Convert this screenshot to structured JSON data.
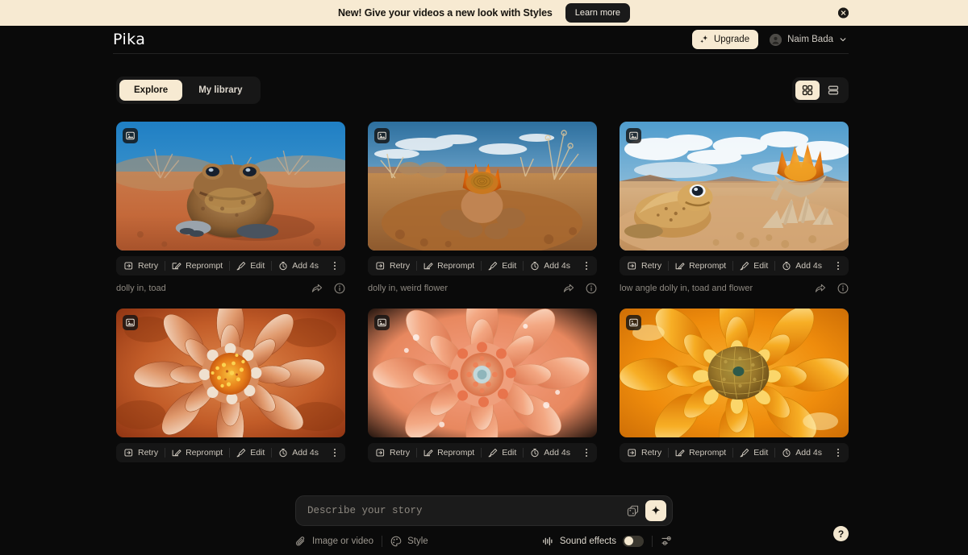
{
  "banner": {
    "text": "New! Give your videos a new look with Styles",
    "cta_label": "Learn more",
    "close_icon": "close-circle-icon",
    "background": "#f7ead2"
  },
  "header": {
    "logo": "Pika",
    "upgrade_label": "Upgrade",
    "upgrade_icon": "sparkle-icon",
    "user_name": "Naim Bada",
    "chevron_icon": "chevron-down-icon",
    "avatar_icon": "avatar-icon"
  },
  "toolbar": {
    "tabs": [
      {
        "label": "Explore",
        "active": true
      },
      {
        "label": "My library",
        "active": false
      }
    ],
    "views": [
      {
        "icon": "grid-view-icon",
        "active": true
      },
      {
        "icon": "list-view-icon",
        "active": false
      }
    ]
  },
  "card_actions": {
    "retry": "Retry",
    "reprompt": "Reprompt",
    "edit": "Edit",
    "extend": "Add 4s",
    "retry_icon": "retry-icon",
    "reprompt_icon": "reprompt-icon",
    "edit_icon": "edit-brush-icon",
    "extend_icon": "stopwatch-icon",
    "more_icon": "kebab-menu-icon",
    "share_icon": "share-icon",
    "info_icon": "info-icon",
    "media_badge_icon": "image-badge-icon"
  },
  "cards": [
    {
      "caption": "dolly in, toad",
      "image_alt": "desert toad facing camera on red sand with blue sky",
      "palette": {
        "sky": "#2e8ec9",
        "mid": "#c9784a",
        "ground": "#c4683a",
        "subject": "#8a5a32"
      }
    },
    {
      "caption": "dolly in, weird flower",
      "image_alt": "orange cactus bloom on rocky desert ground with clouds",
      "palette": {
        "sky": "#5ba3d0",
        "mid": "#c08a4e",
        "ground": "#b3703e",
        "subject": "#e8700f"
      }
    },
    {
      "caption": "low angle dolly in, toad and flower",
      "image_alt": "frog beside an orange flower on pale desert sand, cloudy sky",
      "palette": {
        "sky": "#7fb6dc",
        "mid": "#cfae86",
        "ground": "#d2a878",
        "subject": "#e8801a"
      }
    },
    {
      "caption": "",
      "image_alt": "macro dahlia with coral and cream petals and orange center",
      "palette": {
        "sky": "#b4502a",
        "mid": "#d07a4a",
        "ground": "#a8421f",
        "subject": "#f0a033"
      }
    },
    {
      "caption": "",
      "image_alt": "macro salmon dahlia with dew drops and pale blue center",
      "palette": {
        "sky": "#e49070",
        "mid": "#ef9e7c",
        "ground": "#d97a58",
        "subject": "#a9c4c8"
      }
    },
    {
      "caption": "",
      "image_alt": "macro golden orange bloom with textured spiral center",
      "palette": {
        "sky": "#e9870f",
        "mid": "#f5a623",
        "ground": "#d5740a",
        "subject": "#7a6a2a"
      }
    }
  ],
  "composer": {
    "placeholder": "Describe your story",
    "value": "",
    "dice_icon": "dice-randomize-icon",
    "generate_icon": "sparkle-icon",
    "tools": [
      {
        "label": "Image or video",
        "icon": "paperclip-icon"
      },
      {
        "label": "Style",
        "icon": "palette-icon"
      }
    ],
    "sound_effects_label": "Sound effects",
    "sound_effects_icon": "waveform-icon",
    "sound_effects_on": false,
    "settings_icon": "sliders-icon",
    "help_label": "?",
    "accent": "#f7ead2"
  }
}
